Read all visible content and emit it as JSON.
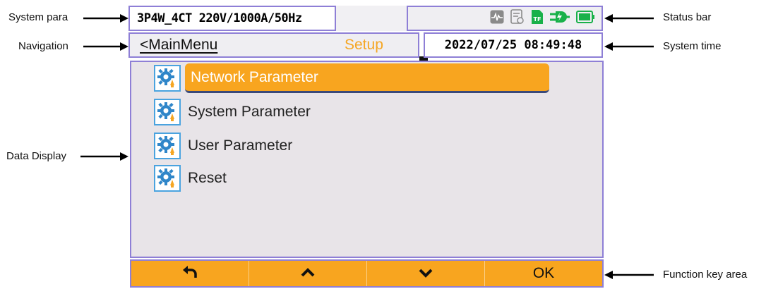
{
  "callouts": {
    "system_para": "System para",
    "navigation": "Navigation",
    "data_display": "Data Display",
    "status_bar": "Status bar",
    "system_time": "System time",
    "function_key_area": "Function key area"
  },
  "header": {
    "system_param": "3P4W_4CT 220V/1000A/50Hz",
    "datetime": "2022/07/25 08:49:48"
  },
  "status_icons": [
    "waveform-icon",
    "report-icon",
    "tf-card-icon",
    "power-plug-icon",
    "battery-icon"
  ],
  "status_tf_text": "TF",
  "nav": {
    "back_label": "<MainMenu",
    "title": "Setup"
  },
  "menu": {
    "items": [
      {
        "label": "Network Parameter",
        "selected": true
      },
      {
        "label": "System Parameter",
        "selected": false
      },
      {
        "label": "User Parameter",
        "selected": false
      },
      {
        "label": "Reset",
        "selected": false
      }
    ]
  },
  "function_keys": {
    "keys": [
      {
        "icon": "back-arrow-icon"
      },
      {
        "icon": "chevron-up-icon"
      },
      {
        "icon": "chevron-down-icon"
      },
      {
        "label": "OK"
      }
    ]
  },
  "colors": {
    "accent": "#f8a51f",
    "frame": "#8e7fd6",
    "status_green": "#19b14a",
    "icon_blue": "#2f86c9"
  }
}
